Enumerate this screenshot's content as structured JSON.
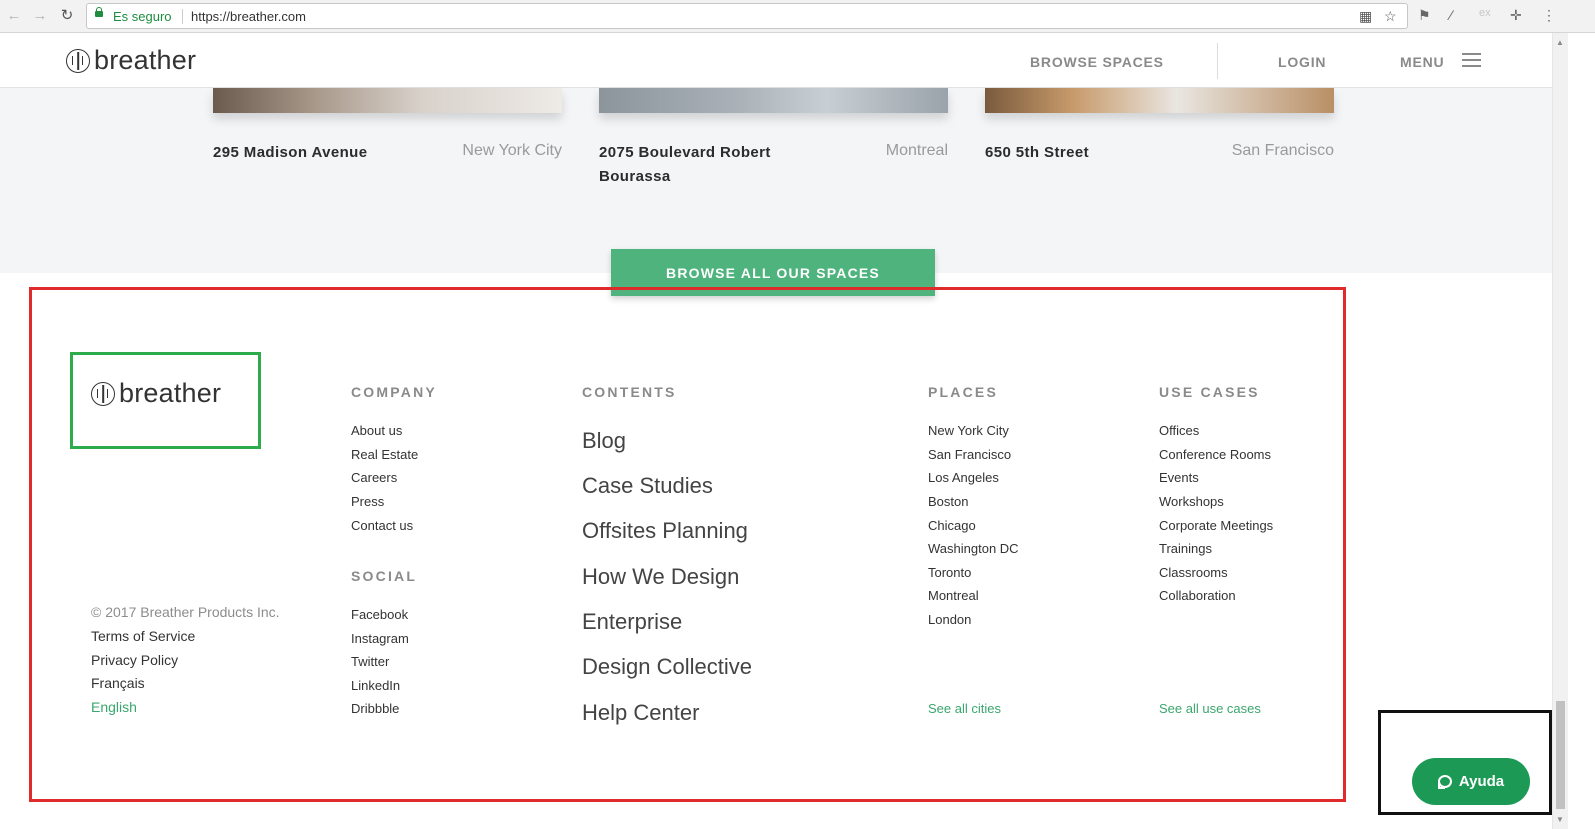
{
  "browser": {
    "secure_label": "Es seguro",
    "url": "https://breather.com"
  },
  "header": {
    "logo_text": "breather",
    "browse_spaces": "BROWSE SPACES",
    "login": "LOGIN",
    "menu": "MENU"
  },
  "spaces": [
    {
      "name": "295 Madison Avenue",
      "city": "New York City"
    },
    {
      "name_line1": "2075 Boulevard Robert",
      "name_line2": "Bourassa",
      "city": "Montreal"
    },
    {
      "name": "650 5th Street",
      "city": "San Francisco"
    }
  ],
  "browse_all_label": "BROWSE ALL OUR SPACES",
  "footer": {
    "logo_text": "breather",
    "company": {
      "heading": "COMPANY",
      "links": [
        "About us",
        "Real Estate",
        "Careers",
        "Press",
        "Contact us"
      ]
    },
    "social": {
      "heading": "SOCIAL",
      "links": [
        "Facebook",
        "Instagram",
        "Twitter",
        "LinkedIn",
        "Dribbble"
      ]
    },
    "contents": {
      "heading": "CONTENTS",
      "links": [
        "Blog",
        "Case Studies",
        "Offsites Planning",
        "How We Design",
        "Enterprise",
        "Design Collective",
        "Help Center"
      ]
    },
    "places": {
      "heading": "PLACES",
      "links": [
        "New York City",
        "San Francisco",
        "Los Angeles",
        "Boston",
        "Chicago",
        "Washington DC",
        "Toronto",
        "Montreal",
        "London"
      ],
      "see_all": "See all cities"
    },
    "use_cases": {
      "heading": "USE CASES",
      "links": [
        "Offices",
        "Conference Rooms",
        "Events",
        "Workshops",
        "Corporate Meetings",
        "Trainings",
        "Classrooms",
        "Collaboration"
      ],
      "see_all": "See all use cases"
    },
    "legal": {
      "copyright": "© 2017 Breather Products Inc.",
      "terms": "Terms of Service",
      "privacy": "Privacy Policy",
      "francais": "Français",
      "english": "English"
    }
  },
  "help_button": "Ayuda",
  "colors": {
    "brand_green": "#4fb37e",
    "link_green": "#3ba66d",
    "help_green": "#1c9a55",
    "annotation_red": "#e02b2b",
    "annotation_green": "#2eab4a"
  }
}
